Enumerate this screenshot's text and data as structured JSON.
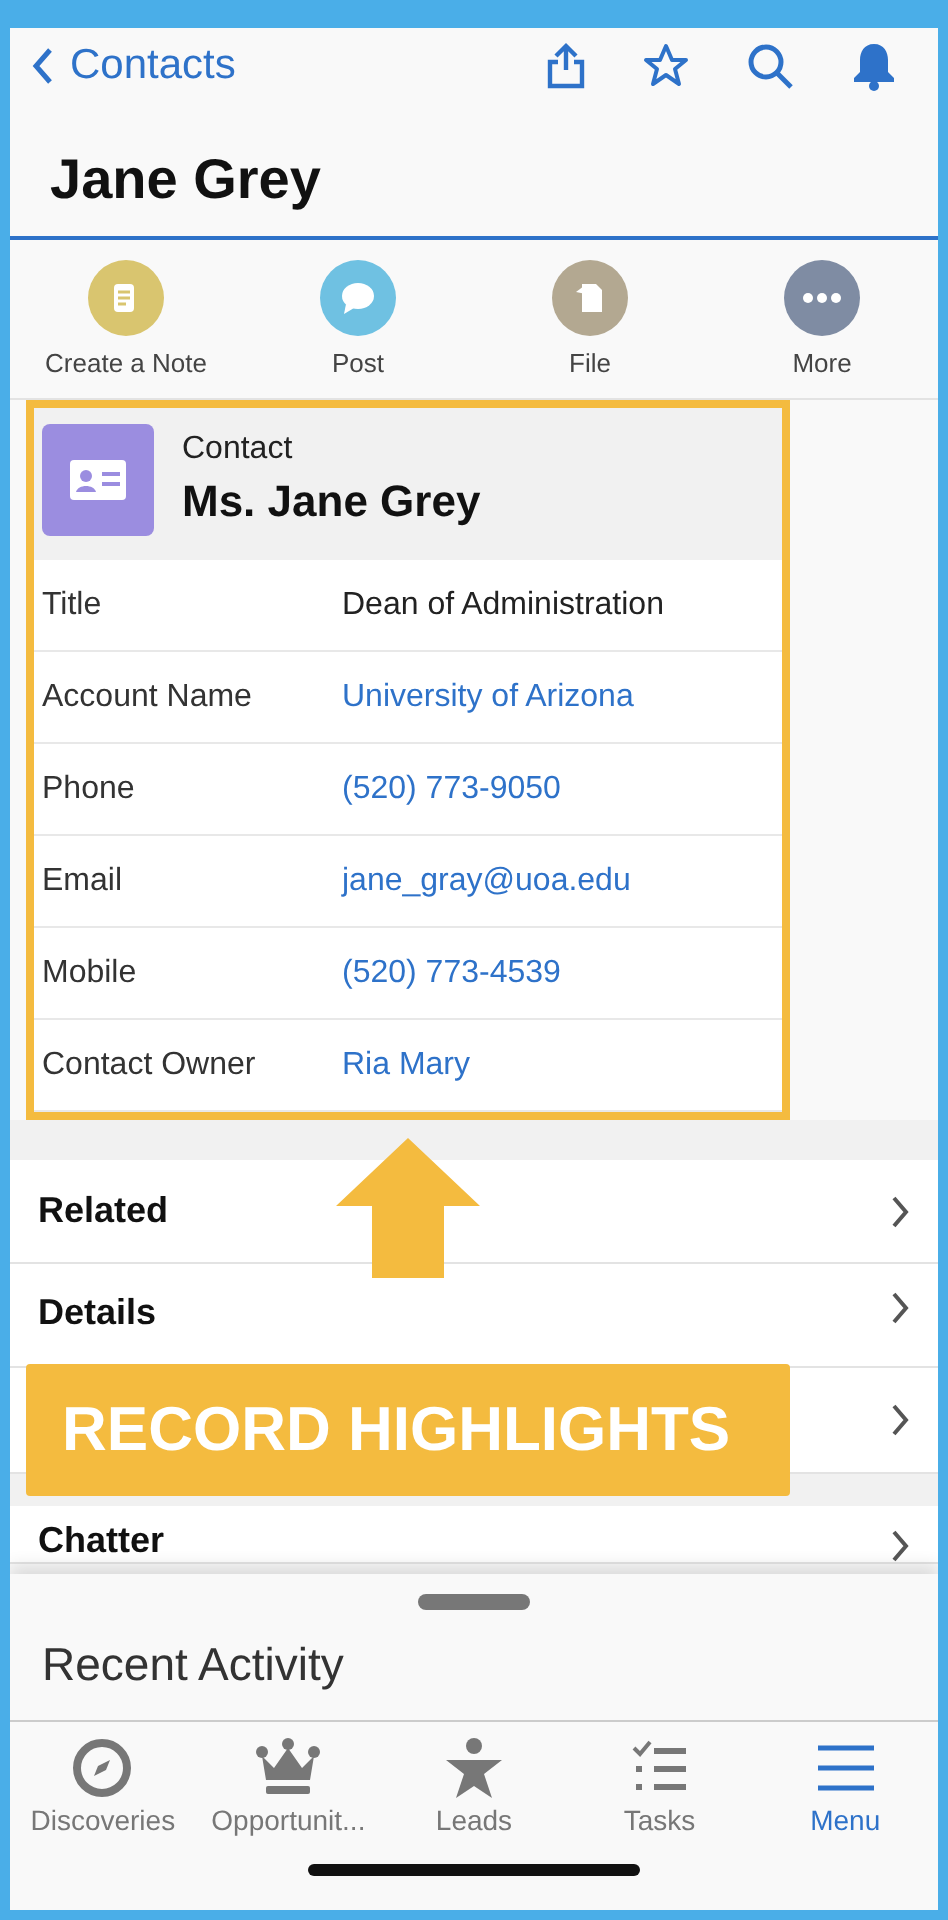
{
  "nav": {
    "back": "Contacts"
  },
  "title": "Jane Grey",
  "actions": [
    {
      "kind": "note",
      "label": "Create a Note",
      "color": "#d9c56f"
    },
    {
      "kind": "post",
      "label": "Post",
      "color": "#6fc1e2"
    },
    {
      "kind": "file",
      "label": "File",
      "color": "#b3a891"
    },
    {
      "kind": "more",
      "label": "More",
      "color": "#7f8ca3"
    }
  ],
  "highlights": {
    "type": "Contact",
    "name": "Ms. Jane Grey",
    "fields": [
      {
        "label": "Title",
        "value": "Dean of Administration",
        "kind": "text"
      },
      {
        "label": "Account Name",
        "value": "University of Arizona",
        "kind": "link"
      },
      {
        "label": "Phone",
        "value": "(520) 773-9050",
        "kind": "link"
      },
      {
        "label": "Email",
        "value": "jane_gray@uoa.edu",
        "kind": "link"
      },
      {
        "label": "Mobile",
        "value": "(520) 773-4539",
        "kind": "link"
      },
      {
        "label": "Contact Owner",
        "value": "Ria Mary",
        "kind": "link"
      }
    ]
  },
  "sections": [
    {
      "label": "Related"
    },
    {
      "label": "Details"
    }
  ],
  "chatter": "Chatter",
  "sheet": {
    "title": "Recent Activity"
  },
  "tabs": [
    {
      "kind": "compass",
      "label": "Discoveries",
      "selected": false
    },
    {
      "kind": "crown",
      "label": "Opportunit...",
      "selected": false
    },
    {
      "kind": "person",
      "label": "Leads",
      "selected": false
    },
    {
      "kind": "tasks",
      "label": "Tasks",
      "selected": false
    },
    {
      "kind": "menu",
      "label": "Menu",
      "selected": true
    }
  ],
  "annotation": {
    "label": "RECORD HIGHLIGHTS"
  }
}
